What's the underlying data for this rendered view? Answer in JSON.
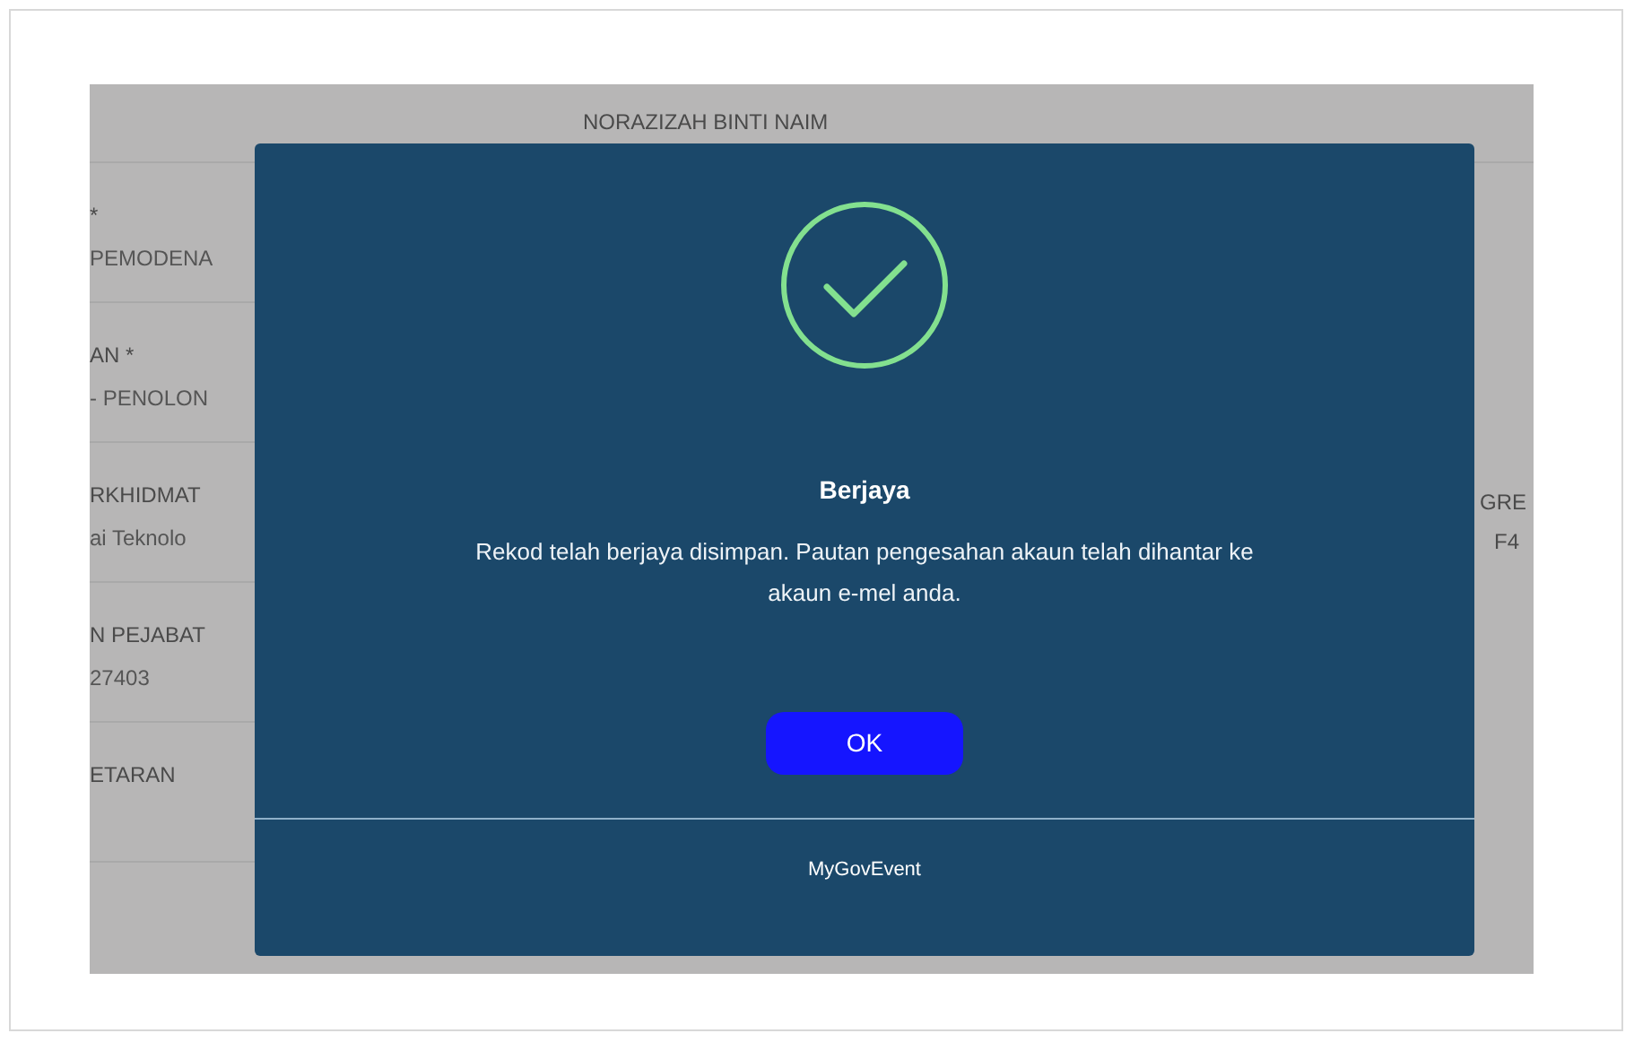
{
  "background_form": {
    "name_value": "NORAZIZAH BINTI NAIM",
    "left_fields": [
      {
        "label": "*",
        "value": "PEMODENA"
      },
      {
        "label": "AN *",
        "value": "- PENOLON"
      },
      {
        "label": "RKHIDMAT",
        "value": "ai Teknolo"
      },
      {
        "label": "N PEJABAT",
        "value": "27403"
      },
      {
        "label": "ETARAN"
      }
    ],
    "right_fields": [
      {
        "label": "GRE",
        "value": "F4"
      }
    ]
  },
  "dialog": {
    "title": "Berjaya",
    "message": "Rekod telah berjaya disimpan. Pautan pengesahan akaun telah dihantar ke akaun e-mel anda.",
    "button": "OK",
    "footer": "MyGovEvent"
  }
}
